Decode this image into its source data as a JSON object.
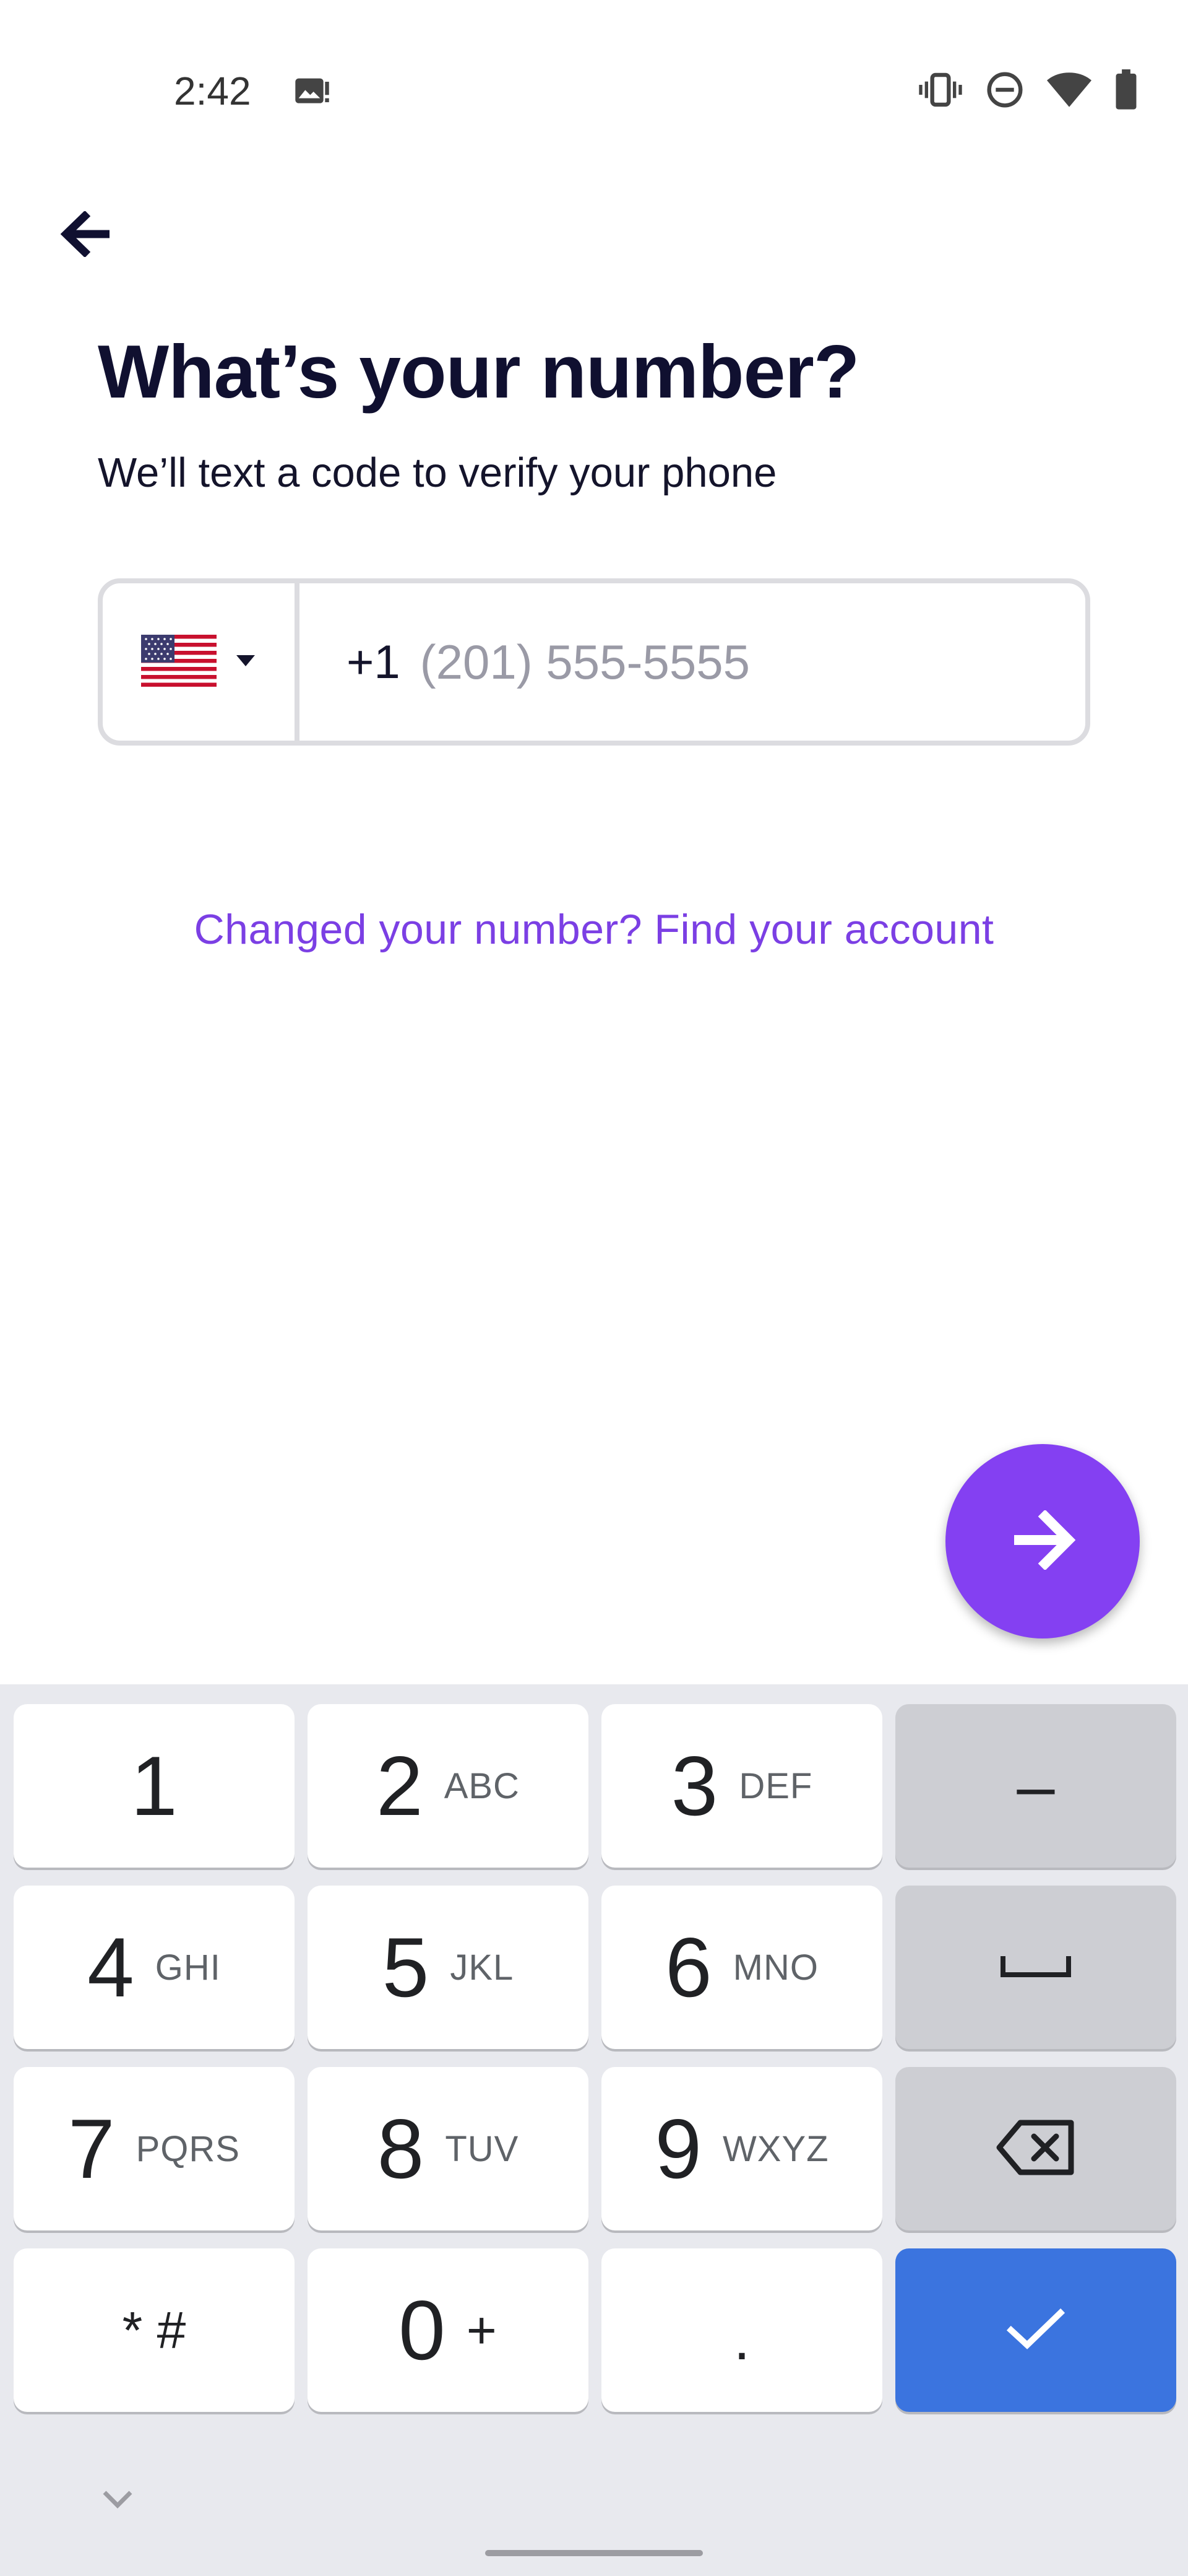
{
  "status_bar": {
    "time": "2:42",
    "icons": [
      "image-notification-icon",
      "vibrate-icon",
      "do-not-disturb-icon",
      "wifi-icon",
      "battery-icon"
    ]
  },
  "header": {
    "back_icon": "arrow-left-icon",
    "title": "What’s your number?",
    "subtitle": "We’ll text a code to verify your phone"
  },
  "phone_field": {
    "country_flag": "us-flag-icon",
    "country_code": "+1",
    "value": "",
    "placeholder": "(201) 555-5555"
  },
  "find_account_link": "Changed your number? Find your account",
  "next_button_icon": "arrow-right-icon",
  "keyboard": {
    "rows": [
      [
        {
          "main": "1",
          "sub": ""
        },
        {
          "main": "2",
          "sub": "ABC"
        },
        {
          "main": "3",
          "sub": "DEF"
        },
        {
          "main": "–",
          "sub": ""
        }
      ],
      [
        {
          "main": "4",
          "sub": "GHI"
        },
        {
          "main": "5",
          "sub": "JKL"
        },
        {
          "main": "6",
          "sub": "MNO"
        },
        {
          "main": "",
          "sub": ""
        }
      ],
      [
        {
          "main": "7",
          "sub": "PQRS"
        },
        {
          "main": "8",
          "sub": "TUV"
        },
        {
          "main": "9",
          "sub": "WXYZ"
        },
        {
          "main": "",
          "sub": ""
        }
      ],
      [
        {
          "main": "* #",
          "sub": ""
        },
        {
          "main": "0",
          "sub": "+"
        },
        {
          "main": ".",
          "sub": ""
        },
        {
          "main": "",
          "sub": ""
        }
      ]
    ]
  },
  "colors": {
    "accent": "#8440f2",
    "link": "#7b3fe4",
    "keyboard_enter": "#3b74df",
    "title": "#101030"
  }
}
